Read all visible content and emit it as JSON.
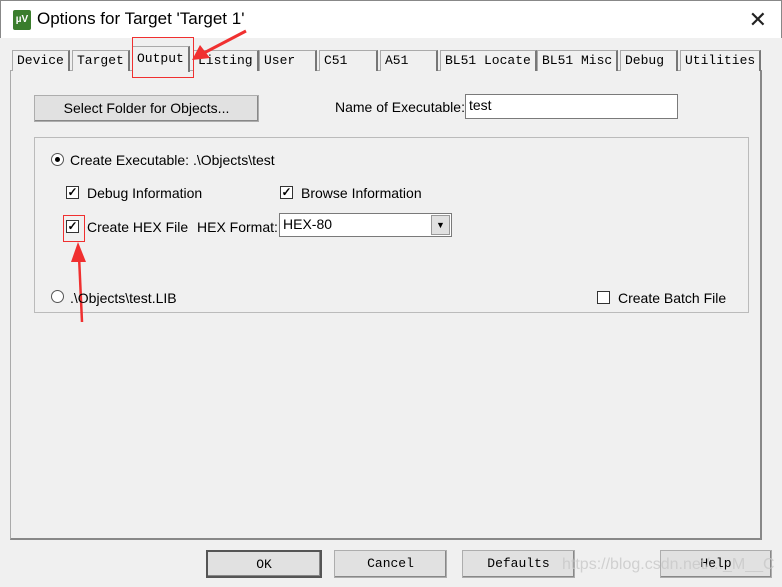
{
  "window": {
    "title": "Options for Target 'Target 1'",
    "icon": "keil-uvision-icon",
    "close": "✕"
  },
  "tabs": [
    {
      "label": "Device"
    },
    {
      "label": "Target"
    },
    {
      "label": "Output",
      "active": true
    },
    {
      "label": "Listing"
    },
    {
      "label": "User"
    },
    {
      "label": "C51"
    },
    {
      "label": "A51"
    },
    {
      "label": "BL51 Locate"
    },
    {
      "label": "BL51 Misc"
    },
    {
      "label": "Debug"
    },
    {
      "label": "Utilities"
    }
  ],
  "output": {
    "select_folder": "Select Folder for Objects...",
    "name_label": "Name of Executable:",
    "name_value": "test",
    "create_exe_label": "Create Executable:  .\\Objects\\test",
    "debug_info": "Debug Information",
    "browse_info": "Browse Information",
    "create_hex": "Create HEX File",
    "hex_format_label": "HEX Format:",
    "hex_format_value": "HEX-80",
    "create_lib_label": ".\\Objects\\test.LIB",
    "batch_file": "Create Batch File"
  },
  "buttons": {
    "ok": "OK",
    "cancel": "Cancel",
    "defaults": "Defaults",
    "help": "Help"
  },
  "watermark": "https://blog.csdn.net/..._M__C",
  "colors": {
    "annotation": "#f03030"
  }
}
